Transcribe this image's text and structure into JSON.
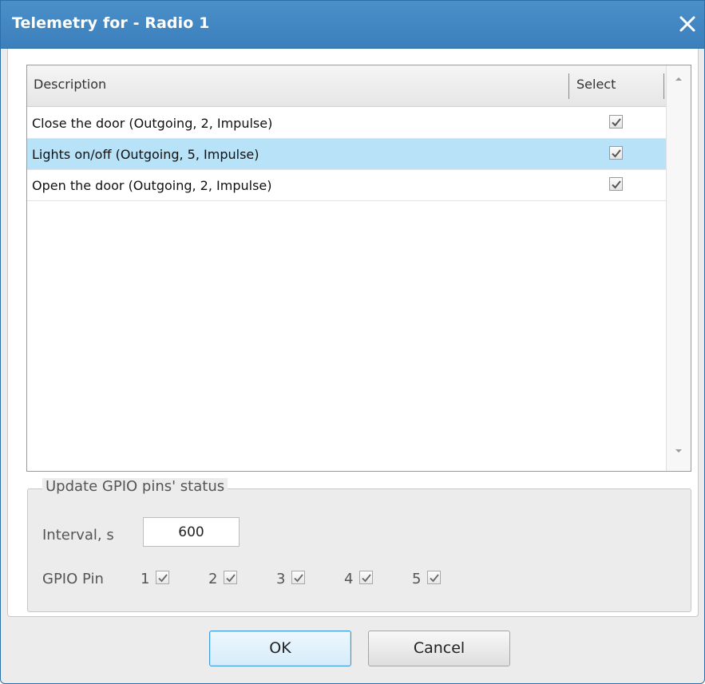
{
  "window": {
    "title": "Telemetry for - Radio 1",
    "close_icon": "close-icon",
    "title_bar_color": "#3b7fbc"
  },
  "grid": {
    "columns": [
      "Description",
      "Select"
    ],
    "rows": [
      {
        "description": "Close the door (Outgoing, 2, Impulse)",
        "selected": true,
        "highlighted": false
      },
      {
        "description": "Lights on/off (Outgoing, 5, Impulse)",
        "selected": true,
        "highlighted": true
      },
      {
        "description": "Open the door (Outgoing, 2, Impulse)",
        "selected": true,
        "highlighted": false
      }
    ],
    "highlight_color": "#b8e2f8",
    "scroll_up_icon": "scroll-up-arrow-icon",
    "scroll_down_icon": "scroll-down-arrow-icon"
  },
  "gpio_group": {
    "legend": "Update GPIO pins' status",
    "interval_label": "Interval, s",
    "interval_value": "600",
    "pin_label": "GPIO Pin",
    "pins": [
      {
        "number": "1",
        "checked": true
      },
      {
        "number": "2",
        "checked": true
      },
      {
        "number": "3",
        "checked": true
      },
      {
        "number": "4",
        "checked": true
      },
      {
        "number": "5",
        "checked": true
      }
    ]
  },
  "buttons": {
    "ok_label": "OK",
    "cancel_label": "Cancel",
    "ok_border_color": "#3c9ad8"
  }
}
